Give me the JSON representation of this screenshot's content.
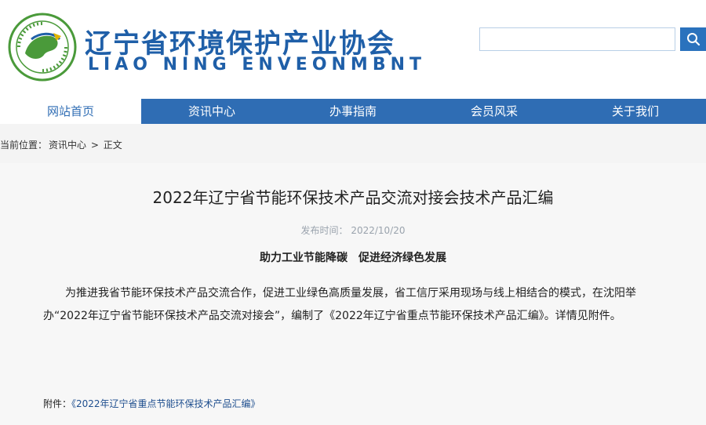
{
  "header": {
    "org_name_cn": "辽宁省环境保护产业协会",
    "org_name_en": "LIAO NING ENVEONMBNT",
    "search": {
      "placeholder": "",
      "value": ""
    },
    "search_icon": "search-icon",
    "colors": {
      "brand": "#1f5fa8",
      "nav": "#2f6db4",
      "accent_green": "#4a9a3a"
    }
  },
  "nav": {
    "items": [
      {
        "label": "网站首页",
        "active": true
      },
      {
        "label": "资讯中心",
        "active": false
      },
      {
        "label": "办事指南",
        "active": false
      },
      {
        "label": "会员风采",
        "active": false
      },
      {
        "label": "关于我们",
        "active": false
      }
    ]
  },
  "breadcrumb": {
    "prefix": "当前位置：",
    "items": [
      "资讯中心",
      "正文"
    ],
    "separator": ">"
  },
  "article": {
    "title": "2022年辽宁省节能环保技术产品交流对接会技术产品汇编",
    "meta": "发布时间： 2022/10/20",
    "subtitle": "助力工业节能降碳　促进经济绿色发展",
    "paragraph": "为推进我省节能环保技术产品交流合作，促进工业绿色高质量发展，省工信厅采用现场与线上相结合的模式，在沈阳举办“2022年辽宁省节能环保技术产品交流对接会”，编制了《2022年辽宁省重点节能环保技术产品汇编》。详情见附件。",
    "attachment": {
      "label": "附件：",
      "link_text": "《2022年辽宁省重点节能环保技术产品汇编》"
    }
  }
}
